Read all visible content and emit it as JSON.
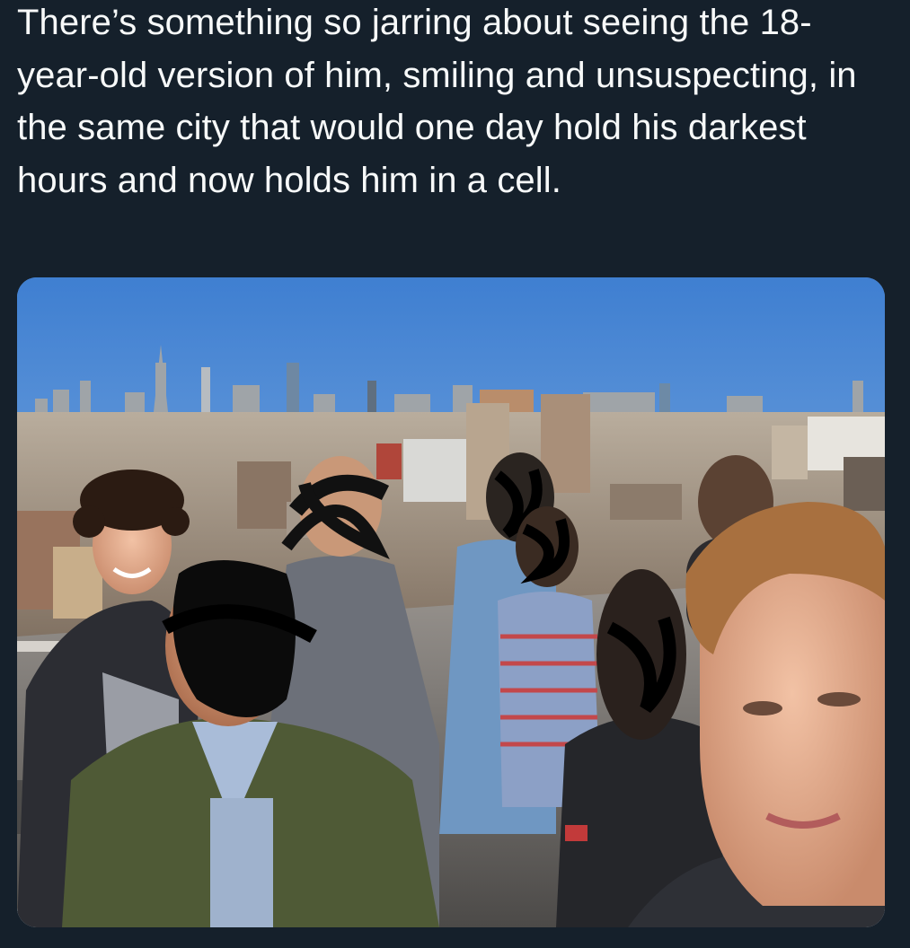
{
  "tweet": {
    "text": "There’s something so jarring about seeing the 18-year-old version of him, smiling and unsuspecting, in the same city that would one day hold his darkest hours and now holds him in a cell."
  },
  "media": {
    "kind": "photo",
    "sky_color": "#5e97da",
    "icon": "photo-icon"
  }
}
